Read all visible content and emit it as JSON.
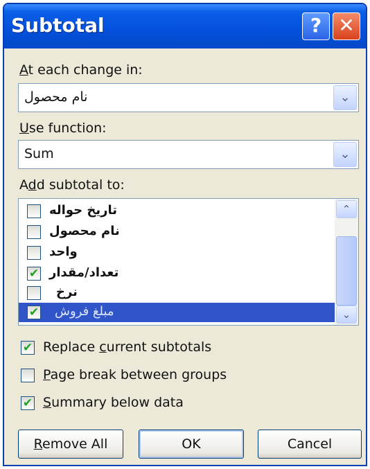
{
  "window": {
    "title": "Subtotal",
    "help_glyph": "?",
    "close_glyph": "✕"
  },
  "at_each_change": {
    "label_underlined": "A",
    "label_rest": "t each change in:",
    "value": "نام محصول",
    "arrow": "⌄"
  },
  "use_function": {
    "label_underlined": "U",
    "label_rest": "se function:",
    "value": "Sum",
    "arrow": "⌄"
  },
  "add_subtotal": {
    "label_pre": "A",
    "label_underlined": "d",
    "label_rest": "d subtotal to:",
    "items": [
      {
        "label": "تاریخ حواله",
        "checked": false,
        "check_glyph": ""
      },
      {
        "label": "نام محصول",
        "checked": false,
        "check_glyph": ""
      },
      {
        "label": "واحد",
        "checked": false,
        "check_glyph": ""
      },
      {
        "label": "تعداد/مقدار",
        "checked": true,
        "check_glyph": "✔"
      },
      {
        "label": "نرخ",
        "checked": false,
        "check_glyph": ""
      },
      {
        "label": "مبلغ فروش",
        "checked": true,
        "check_glyph": "✔",
        "selected": true
      }
    ],
    "scroll_up": "⌃",
    "scroll_down": "⌄"
  },
  "options": {
    "replace": {
      "pre": "Replace ",
      "underlined": "c",
      "rest": "urrent subtotals",
      "checked": true,
      "check_glyph": "✔"
    },
    "page_break": {
      "pre": "",
      "underlined": "P",
      "rest": "age break between groups",
      "checked": false,
      "check_glyph": ""
    },
    "summary": {
      "pre": "",
      "underlined": "S",
      "rest": "ummary below data",
      "checked": true,
      "check_glyph": "✔"
    }
  },
  "buttons": {
    "remove_all": {
      "underlined": "R",
      "rest": "emove All"
    },
    "ok": "OK",
    "cancel": "Cancel"
  }
}
